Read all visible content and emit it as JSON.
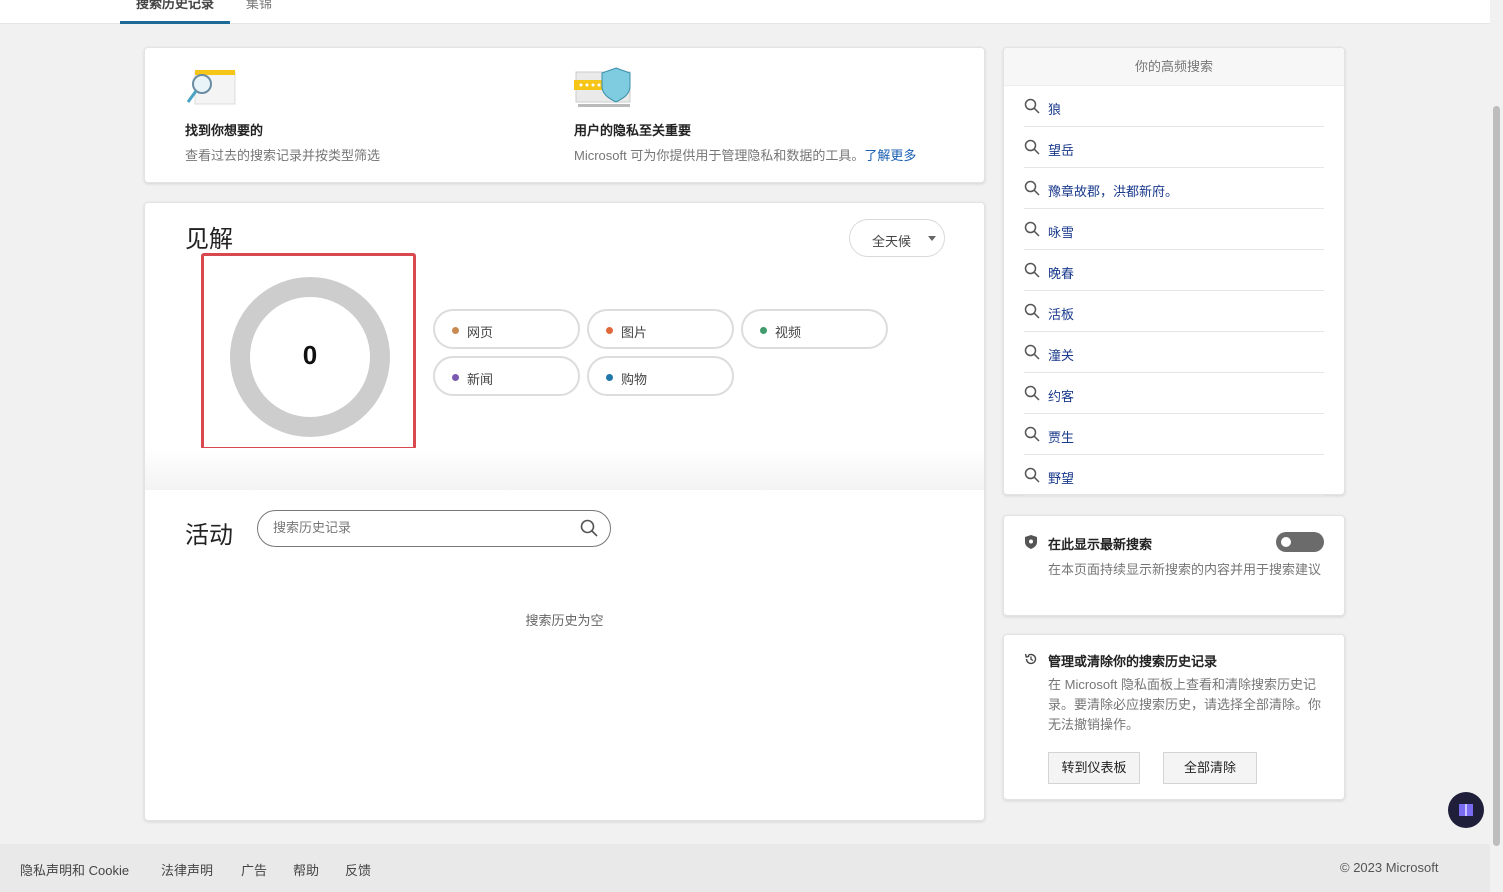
{
  "tabs": [
    {
      "label": "搜索历史记录"
    },
    {
      "label": "集锦"
    }
  ],
  "intro": {
    "find": {
      "title": "找到你想要的",
      "desc": "查看过去的搜索记录并按类型筛选"
    },
    "privacy": {
      "title": "用户的隐私至关重要",
      "desc": "Microsoft 可为你提供用于管理隐私和数据的工具。",
      "link": "了解更多"
    }
  },
  "insights": {
    "title": "见解",
    "range": "全天候",
    "total": "0",
    "categories": [
      {
        "label": "网页",
        "color": "#c98a52"
      },
      {
        "label": "图片",
        "color": "#e0683a"
      },
      {
        "label": "视频",
        "color": "#3f9b6b"
      },
      {
        "label": "新闻",
        "color": "#7a5ab0"
      },
      {
        "label": "购物",
        "color": "#1f78a8"
      }
    ]
  },
  "activity": {
    "title": "活动",
    "search_placeholder": "搜索历史记录",
    "empty": "搜索历史为空"
  },
  "frequent": {
    "title": "你的高频搜索",
    "items": [
      "狼",
      "望岳",
      "豫章故郡，洪都新府。",
      "咏雪",
      "晚春",
      "活板",
      "潼关",
      "约客",
      "贾生",
      "野望"
    ]
  },
  "show_latest": {
    "title": "在此显示最新搜索",
    "desc": "在本页面持续显示新搜索的内容并用于搜索建议",
    "toggle_on": false
  },
  "manage": {
    "title": "管理或清除你的搜索历史记录",
    "desc": "在 Microsoft 隐私面板上查看和清除搜索历史记录。要清除必应搜索历史，请选择全部清除。你无法撤销操作。",
    "dashboard_button": "转到仪表板",
    "clear_button": "全部清除"
  },
  "footer": {
    "links": [
      "隐私声明和 Cookie",
      "法律声明",
      "广告",
      "帮助",
      "反馈"
    ],
    "copyright": "© 2023 Microsoft"
  }
}
